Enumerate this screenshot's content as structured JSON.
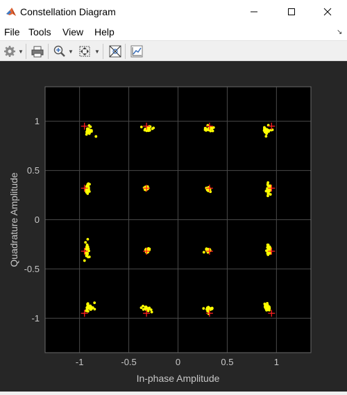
{
  "window": {
    "title": "Constellation Diagram",
    "minimize_glyph": "minimize-icon",
    "maximize_glyph": "maximize-icon",
    "close_glyph": "close-icon"
  },
  "menu": {
    "items": [
      "File",
      "Tools",
      "View",
      "Help"
    ]
  },
  "toolbar": {
    "icons": [
      "gear-icon",
      "print-icon",
      "zoom-in-icon",
      "fit-to-view-icon",
      "measurements-icon",
      "autoscale-icon"
    ]
  },
  "colors": {
    "figure_bg": "#262626",
    "plot_bg": "#000000",
    "grid": "#4a4a4a",
    "received": "#ffff00",
    "reference": "#ff2020"
  },
  "chart_data": {
    "type": "scatter",
    "title": "",
    "xlabel": "In-phase Amplitude",
    "ylabel": "Quadrature Amplitude",
    "xlim": [
      -1.35,
      1.35
    ],
    "ylim": [
      -1.35,
      1.35
    ],
    "xticks": [
      "-1",
      "-0.5",
      "0",
      "0.5",
      "1"
    ],
    "yticks": [
      "1",
      "0.5",
      "0",
      "-0.5",
      "-1"
    ],
    "xtick_values": [
      -1,
      -0.5,
      0,
      0.5,
      1
    ],
    "ytick_values": [
      1,
      0.5,
      0,
      -0.5,
      -1
    ],
    "grid": true,
    "series": [
      {
        "marker": "+",
        "color": "#ff2020",
        "points": [
          [
            -0.95,
            0.95
          ],
          [
            -0.32,
            0.95
          ],
          [
            0.32,
            0.95
          ],
          [
            0.95,
            0.95
          ],
          [
            -0.95,
            0.32
          ],
          [
            -0.32,
            0.32
          ],
          [
            0.32,
            0.32
          ],
          [
            0.95,
            0.32
          ],
          [
            -0.95,
            -0.32
          ],
          [
            -0.32,
            -0.32
          ],
          [
            0.32,
            -0.32
          ],
          [
            0.95,
            -0.32
          ],
          [
            -0.95,
            -0.95
          ],
          [
            -0.32,
            -0.95
          ],
          [
            0.32,
            -0.95
          ],
          [
            0.95,
            -0.95
          ]
        ]
      },
      {
        "marker": "dot",
        "color": "#ffff00",
        "clusters": [
          {
            "center": [
              -0.9,
              0.9
            ],
            "spread": [
              0.04,
              0.04
            ],
            "angle": -45
          },
          {
            "center": [
              -0.31,
              0.92
            ],
            "spread": [
              0.05,
              0.02
            ],
            "angle": 10
          },
          {
            "center": [
              0.31,
              0.92
            ],
            "spread": [
              0.05,
              0.02
            ],
            "angle": -10
          },
          {
            "center": [
              0.9,
              0.9
            ],
            "spread": [
              0.04,
              0.04
            ],
            "angle": 45
          },
          {
            "center": [
              -0.92,
              0.31
            ],
            "spread": [
              0.02,
              0.05
            ],
            "angle": 0
          },
          {
            "center": [
              -0.32,
              0.32
            ],
            "spread": [
              0.02,
              0.02
            ],
            "angle": 0
          },
          {
            "center": [
              0.31,
              0.31
            ],
            "spread": [
              0.02,
              0.02
            ],
            "angle": 0
          },
          {
            "center": [
              0.92,
              0.31
            ],
            "spread": [
              0.02,
              0.05
            ],
            "angle": 0
          },
          {
            "center": [
              -0.92,
              -0.3
            ],
            "spread": [
              0.02,
              0.06
            ],
            "angle": 0
          },
          {
            "center": [
              -0.31,
              -0.31
            ],
            "spread": [
              0.02,
              0.02
            ],
            "angle": 0
          },
          {
            "center": [
              0.31,
              -0.31
            ],
            "spread": [
              0.02,
              0.015
            ],
            "angle": 0
          },
          {
            "center": [
              0.92,
              -0.31
            ],
            "spread": [
              0.02,
              0.05
            ],
            "angle": 0
          },
          {
            "center": [
              -0.9,
              -0.89
            ],
            "spread": [
              0.04,
              0.04
            ],
            "angle": 45
          },
          {
            "center": [
              -0.31,
              -0.91
            ],
            "spread": [
              0.05,
              0.02
            ],
            "angle": -10
          },
          {
            "center": [
              0.31,
              -0.91
            ],
            "spread": [
              0.05,
              0.02
            ],
            "angle": 10
          },
          {
            "center": [
              0.9,
              -0.89
            ],
            "spread": [
              0.04,
              0.04
            ],
            "angle": -45
          }
        ]
      }
    ]
  }
}
